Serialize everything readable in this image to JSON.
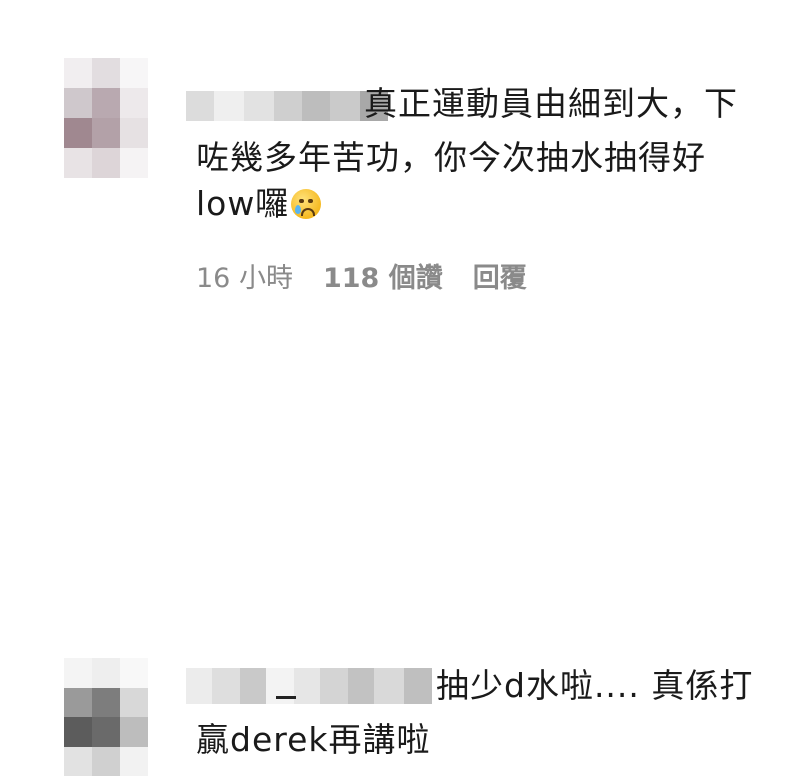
{
  "comments": [
    {
      "text_line1": "真正運動員由細到大，下",
      "text_line2": "咗幾多年苦功，你今次抽水抽得好",
      "text_line3": "low囉",
      "emoji": "crying-face-emoji",
      "time": "16 小時",
      "likes": "118 個讚",
      "reply": "回覆"
    },
    {
      "text_line1": "抽少d水啦.... 真係打",
      "text_line2": "贏derek再講啦"
    }
  ],
  "colors": {
    "text": "#1a1a1a",
    "meta": "#8a8a8a",
    "background": "#ffffff"
  }
}
